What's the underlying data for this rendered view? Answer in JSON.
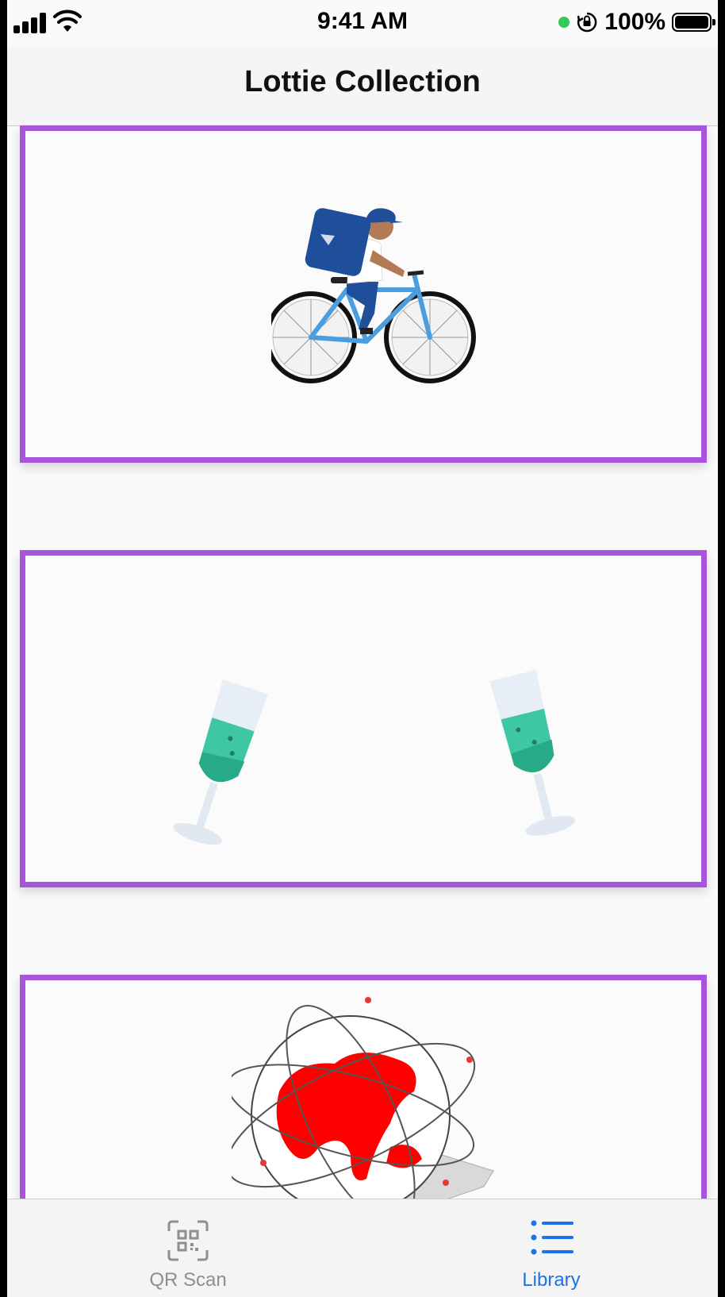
{
  "status_bar": {
    "time": "9:41 AM",
    "battery_percent": "100%",
    "icons": [
      "cellular-signal-icon",
      "wifi-icon",
      "active-indicator-icon",
      "orientation-lock-icon",
      "battery-icon"
    ],
    "indicator_color": "#34c759"
  },
  "nav": {
    "title": "Lottie Collection"
  },
  "library": {
    "border_color": "#a855dc",
    "items": [
      {
        "animation": "delivery-cyclist"
      },
      {
        "animation": "champagne-toast"
      },
      {
        "animation": "globe-network"
      }
    ]
  },
  "tab_bar": {
    "active_color": "#1a73e8",
    "inactive_color": "#8e8e93",
    "tabs": [
      {
        "label": "QR Scan",
        "icon": "qr-scan-icon",
        "active": false
      },
      {
        "label": "Library",
        "icon": "list-icon",
        "active": true
      }
    ]
  }
}
